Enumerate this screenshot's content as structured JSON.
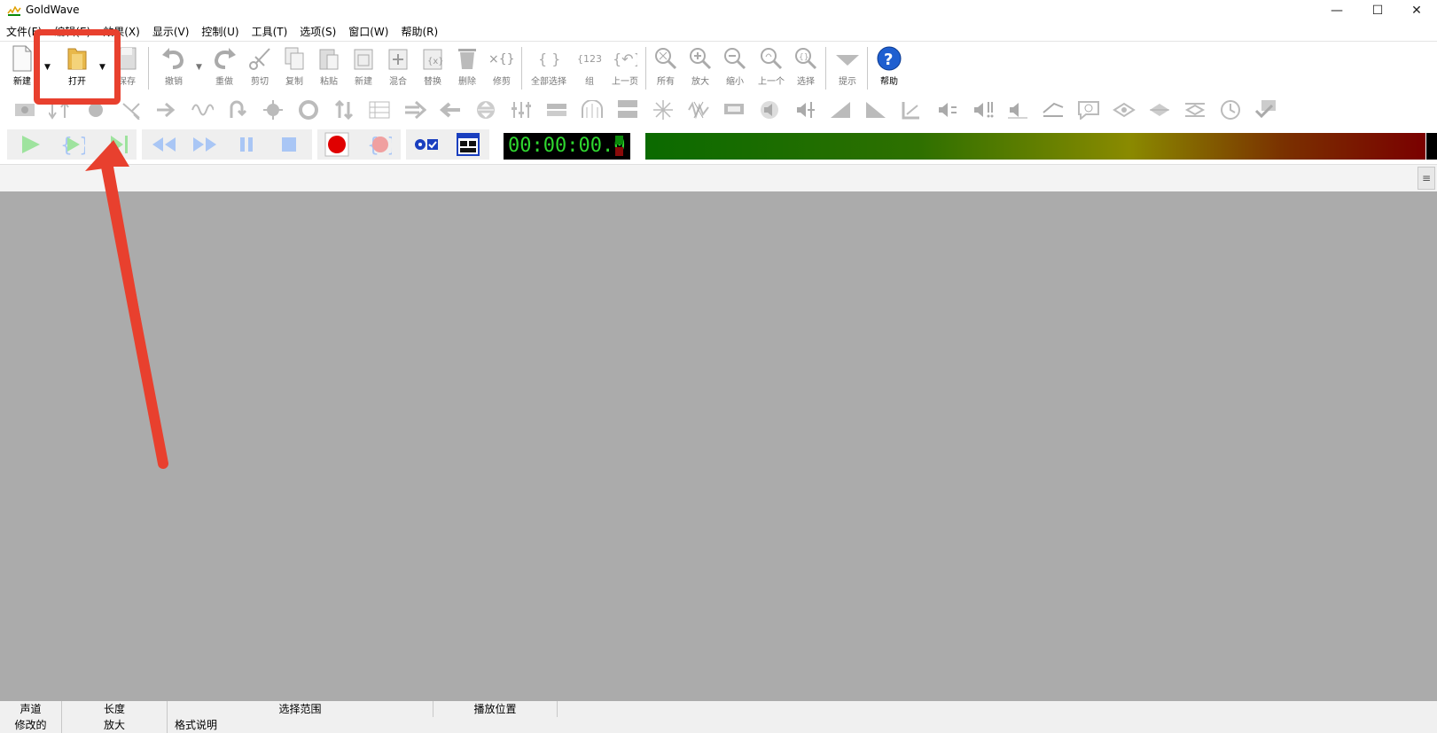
{
  "window": {
    "title": "GoldWave",
    "controls": {
      "minimize": "—",
      "maximize": "☐",
      "close": "✕"
    }
  },
  "menu": [
    "文件(F)",
    "编辑(E)",
    "效果(X)",
    "显示(V)",
    "控制(U)",
    "工具(T)",
    "选项(S)",
    "窗口(W)",
    "帮助(R)"
  ],
  "toolbar": {
    "new": "新建",
    "open": "打开",
    "save": "保存",
    "undo": "撤销",
    "redo": "重做",
    "cut": "剪切",
    "copy": "复制",
    "paste": "粘贴",
    "paste_new": "新建",
    "mix": "混合",
    "replace": "替换",
    "delete": "删除",
    "trim": "修剪",
    "select_all": "全部选择",
    "set": "组",
    "prev_page": "上一页",
    "all": "所有",
    "zoom_in": "放大",
    "zoom_out": "缩小",
    "previous": "上一个",
    "select": "选择",
    "cue": "提示",
    "help": "帮助"
  },
  "timer": {
    "value": "00:00:00.0"
  },
  "status": {
    "row1": [
      "声道",
      "长度",
      "选择范围",
      "播放位置"
    ],
    "row2": [
      "修改的",
      "放大",
      "格式说明"
    ]
  },
  "annotation": {
    "highlight_color": "#e8402e"
  }
}
